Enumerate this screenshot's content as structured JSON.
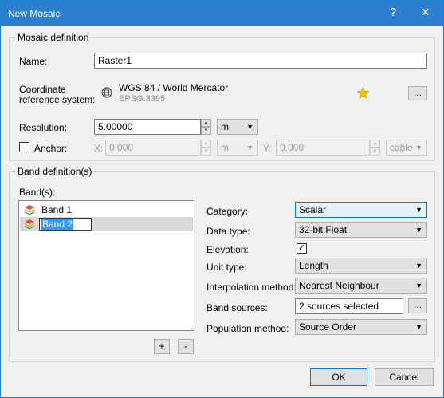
{
  "window": {
    "title": "New Mosaic",
    "help": "?",
    "close": "✕"
  },
  "mosaic": {
    "legend": "Mosaic definition",
    "name_label": "Name:",
    "name_value": "Raster1",
    "crs_label_1": "Coordinate",
    "crs_label_2": "reference system:",
    "crs_name": "WGS 84 / World Mercator",
    "crs_code": "EPSG:3395",
    "crs_button": "...",
    "resolution_label": "Resolution:",
    "resolution_value": "5.00000",
    "resolution_unit": "m",
    "anchor_label": "Anchor:",
    "anchor_checked": false,
    "x_label": "X:",
    "x_value": "0.000",
    "x_unit": "m",
    "y_label": "Y:",
    "y_value": "0.000",
    "y_unit": "cable"
  },
  "band": {
    "legend": "Band definition(s)",
    "bands_label": "Band(s):",
    "items": [
      {
        "label": "Band 1"
      },
      {
        "label": "Band 2"
      }
    ],
    "add_button": "+",
    "remove_button": "-",
    "category_label": "Category:",
    "category_value": "Scalar",
    "datatype_label": "Data type:",
    "datatype_value": "32-bit Float",
    "elevation_label": "Elevation:",
    "elevation_checked": true,
    "unittype_label": "Unit type:",
    "unittype_value": "Length",
    "interp_label": "Interpolation method:",
    "interp_value": "Nearest Neighbour",
    "sources_label": "Band sources:",
    "sources_value": "2 sources selected",
    "sources_button": "...",
    "population_label": "Population method:",
    "population_value": "Source Order"
  },
  "footer": {
    "ok": "OK",
    "cancel": "Cancel"
  },
  "colors": {
    "titlebar": "#2b7fce",
    "selection": "#3399ff",
    "star": "#f5c400"
  }
}
